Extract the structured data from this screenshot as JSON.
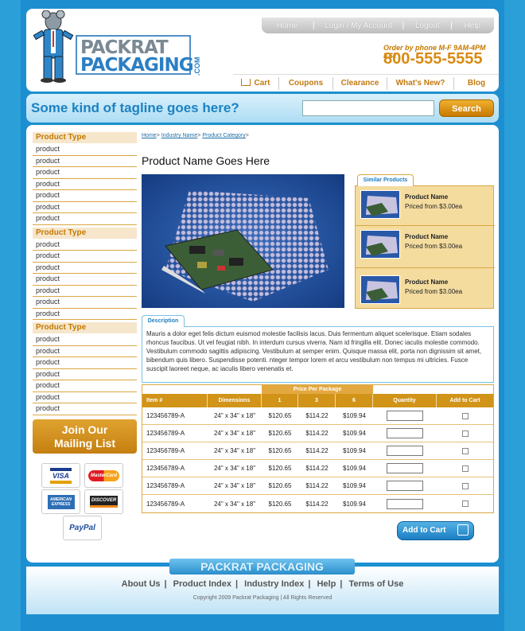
{
  "brand": {
    "line1": "PACKRAT",
    "line2": "PACKAGING",
    "com": ".COM",
    "footer_logo": "PACKRAT PACKAGING"
  },
  "topnav": [
    "Home",
    "Login / My Account",
    "Logout",
    "Help"
  ],
  "phone": {
    "label": "Order by phone M-F 9AM-4PM EST",
    "number": "800-555-5555"
  },
  "mainnav": [
    "Cart",
    "Coupons",
    "Clearance",
    "What's New?",
    "Blog"
  ],
  "tagline": "Some kind of tagline goes here?",
  "search": {
    "button": "Search",
    "placeholder": ""
  },
  "sidebar": {
    "groups": [
      {
        "title": "Product Type",
        "items": [
          "product",
          "product",
          "product",
          "product",
          "product",
          "product",
          "product"
        ]
      },
      {
        "title": "Product Type",
        "items": [
          "product",
          "product",
          "product",
          "product",
          "product",
          "product",
          "product"
        ]
      },
      {
        "title": "Product Type",
        "items": [
          "product",
          "product",
          "product",
          "product",
          "product",
          "product",
          "product"
        ]
      }
    ],
    "mailing": "Join Our Mailing List",
    "cards": [
      "VISA",
      "MasterCard",
      "AMERICAN EXPRESS",
      "DISCOVER",
      "PayPal"
    ]
  },
  "breadcrumb": [
    "Home",
    "Industry Name",
    "Product Category"
  ],
  "product": {
    "title": "Product Name Goes Here",
    "similar_tab": "Similar Products",
    "similar": [
      {
        "name": "Product Name",
        "price": "Priced from $3.00ea"
      },
      {
        "name": "Product Name",
        "price": "Priced from $3.00ea"
      },
      {
        "name": "Product Name",
        "price": "Priced from $3.00ea"
      }
    ],
    "desc_tab": "Description",
    "description": "Mauris a dolor eget felis dictum euismod molestie facilisis lacus. Duis fermentum aliquet scelerisque. Etiam sodales rhoncus faucibus. Ut vel feugiat nibh. In interdum cursus viverra. Nam id fringilla elit. Donec iaculis molestie commodo. Vestibulum commodo sagittis adipiscing. Vestibulum at semper enim. Quisque massa elit, porta non dignissim sit amet, bibendum quis libero. Suspendisse potenti. nteger tempor lorem et arcu vestibulum non tempus mi ultricies. Fusce suscipit laoreet neque, ac iaculis libero venenatis et."
  },
  "table": {
    "price_per_package": "Price Per Package",
    "headers": [
      "Item #",
      "Dimensions",
      "1",
      "3",
      "6",
      "Quantity",
      "Add to Cart"
    ],
    "rows": [
      [
        "123456789-A",
        "24\" x 34\" x 18\"",
        "$120.65",
        "$114.22",
        "$109.94"
      ],
      [
        "123456789-A",
        "24\" x 34\" x 18\"",
        "$120.65",
        "$114.22",
        "$109.94"
      ],
      [
        "123456789-A",
        "24\" x 34\" x 18\"",
        "$120.65",
        "$114.22",
        "$109.94"
      ],
      [
        "123456789-A",
        "24\" x 34\" x 18\"",
        "$120.65",
        "$114.22",
        "$109.94"
      ],
      [
        "123456789-A",
        "24\" x 34\" x 18\"",
        "$120.65",
        "$114.22",
        "$109.94"
      ],
      [
        "123456789-A",
        "24\" x 34\" x 18\"",
        "$120.65",
        "$114.22",
        "$109.94"
      ]
    ],
    "add_to_cart": "Add to Cart"
  },
  "footer": {
    "links": [
      "About Us",
      "Product Index",
      "Industry Index",
      "Help",
      "Terms of Use"
    ],
    "copyright": "Copyright 2009 Packrat Packaging | All Rights Reserved"
  },
  "colors": {
    "brand_blue": "#1b82c3",
    "accent_orange": "#d98a10",
    "table_gold": "#d19418"
  }
}
